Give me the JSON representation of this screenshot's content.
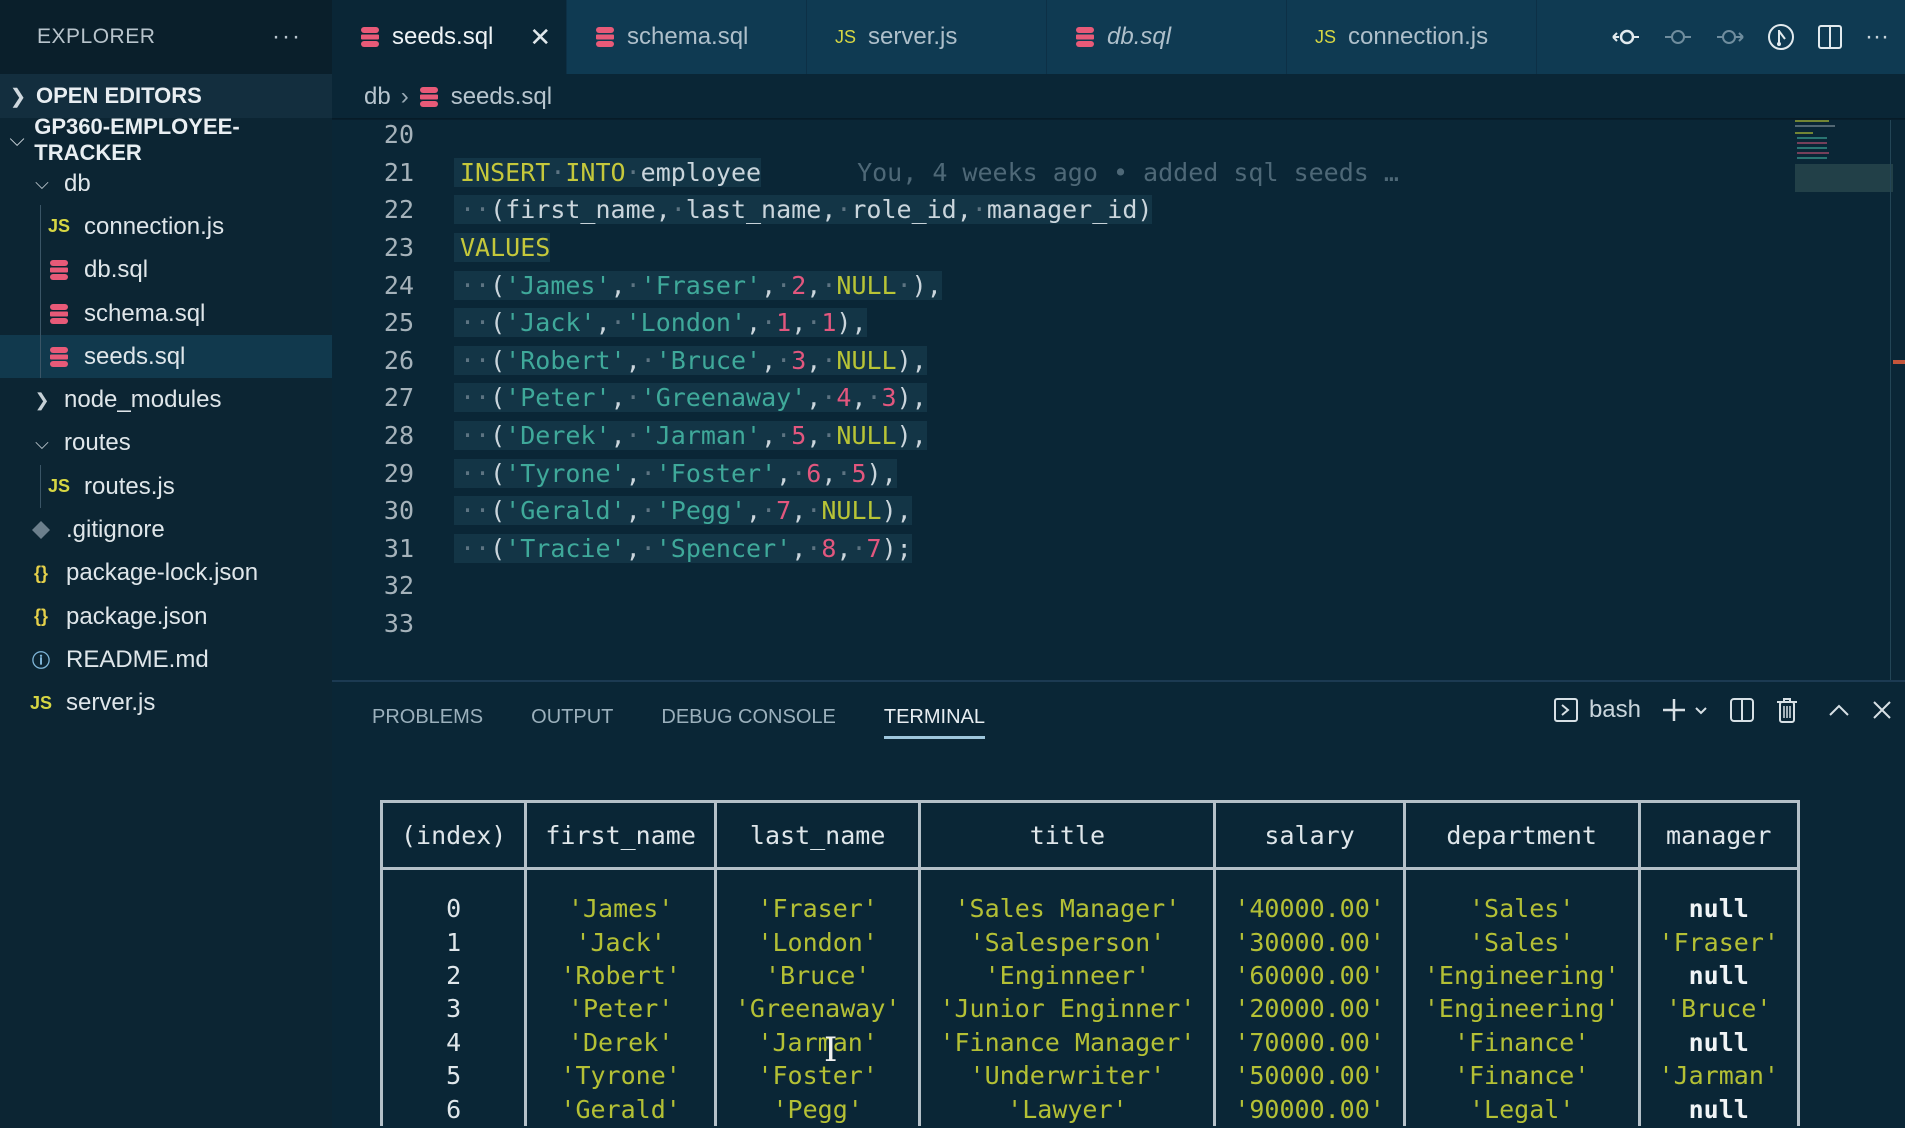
{
  "sidebar": {
    "title": "EXPLORER",
    "more": "···",
    "open_editors": "OPEN EDITORS",
    "project": "GP360-EMPLOYEE-TRACKER",
    "tree": [
      {
        "label": "db",
        "type": "folder",
        "expanded": true,
        "depth": 1
      },
      {
        "label": "connection.js",
        "type": "js",
        "depth": 2
      },
      {
        "label": "db.sql",
        "type": "sql",
        "depth": 2
      },
      {
        "label": "schema.sql",
        "type": "sql",
        "depth": 2
      },
      {
        "label": "seeds.sql",
        "type": "sql",
        "depth": 2,
        "selected": true
      },
      {
        "label": "node_modules",
        "type": "folder",
        "expanded": false,
        "depth": 1
      },
      {
        "label": "routes",
        "type": "folder",
        "expanded": true,
        "depth": 1
      },
      {
        "label": "routes.js",
        "type": "js",
        "depth": 2
      },
      {
        "label": ".gitignore",
        "type": "git",
        "depth": 1
      },
      {
        "label": "package-lock.json",
        "type": "json",
        "depth": 1
      },
      {
        "label": "package.json",
        "type": "json",
        "depth": 1
      },
      {
        "label": "README.md",
        "type": "info",
        "depth": 1
      },
      {
        "label": "server.js",
        "type": "js",
        "depth": 1
      }
    ]
  },
  "tabs": [
    {
      "label": "seeds.sql",
      "type": "sql",
      "active": true
    },
    {
      "label": "schema.sql",
      "type": "sql"
    },
    {
      "label": "server.js",
      "type": "js"
    },
    {
      "label": "db.sql",
      "type": "sql",
      "italic": true
    },
    {
      "label": "connection.js",
      "type": "js"
    }
  ],
  "icons": {
    "js": "JS",
    "json": "{}",
    "info": "ⓘ",
    "close": "✕",
    "chev_right": "›",
    "chev_down": "⌄",
    "more": "···"
  },
  "breadcrumb": {
    "folder": "db",
    "file": "seeds.sql"
  },
  "editor": {
    "blame": "You, 4 weeks ago • added sql seeds …",
    "lines": [
      {
        "n": "20",
        "tokens": []
      },
      {
        "n": "21",
        "tokens": [
          [
            "kw",
            "INSERT"
          ],
          [
            "ws",
            "·"
          ],
          [
            "kw",
            "INTO"
          ],
          [
            "ws",
            "·"
          ],
          [
            "plain",
            "employee"
          ]
        ],
        "blame": true
      },
      {
        "n": "22",
        "tokens": [
          [
            "ws",
            "··"
          ],
          [
            "plain",
            "(first_name,"
          ],
          [
            "ws",
            "·"
          ],
          [
            "plain",
            "last_name,"
          ],
          [
            "ws",
            "·"
          ],
          [
            "plain",
            "role_id,"
          ],
          [
            "ws",
            "·"
          ],
          [
            "plain",
            "manager_id)"
          ]
        ]
      },
      {
        "n": "23",
        "tokens": [
          [
            "kw",
            "VALUES"
          ]
        ]
      },
      {
        "n": "24",
        "tokens": [
          [
            "ws",
            "··"
          ],
          [
            "plain",
            "("
          ],
          [
            "str",
            "'James'"
          ],
          [
            "plain",
            ","
          ],
          [
            "ws",
            "·"
          ],
          [
            "str",
            "'Fraser'"
          ],
          [
            "plain",
            ","
          ],
          [
            "ws",
            "·"
          ],
          [
            "num",
            "2"
          ],
          [
            "plain",
            ","
          ],
          [
            "ws",
            "·"
          ],
          [
            "null",
            "NULL"
          ],
          [
            "ws",
            "·"
          ],
          [
            "plain",
            "),"
          ]
        ]
      },
      {
        "n": "25",
        "tokens": [
          [
            "ws",
            "··"
          ],
          [
            "plain",
            "("
          ],
          [
            "str",
            "'Jack'"
          ],
          [
            "plain",
            ","
          ],
          [
            "ws",
            "·"
          ],
          [
            "str",
            "'London'"
          ],
          [
            "plain",
            ","
          ],
          [
            "ws",
            "·"
          ],
          [
            "num",
            "1"
          ],
          [
            "plain",
            ","
          ],
          [
            "ws",
            "·"
          ],
          [
            "num",
            "1"
          ],
          [
            "plain",
            "),"
          ]
        ]
      },
      {
        "n": "26",
        "tokens": [
          [
            "ws",
            "··"
          ],
          [
            "plain",
            "("
          ],
          [
            "str",
            "'Robert'"
          ],
          [
            "plain",
            ","
          ],
          [
            "ws",
            "·"
          ],
          [
            "str",
            "'Bruce'"
          ],
          [
            "plain",
            ","
          ],
          [
            "ws",
            "·"
          ],
          [
            "num",
            "3"
          ],
          [
            "plain",
            ","
          ],
          [
            "ws",
            "·"
          ],
          [
            "null",
            "NULL"
          ],
          [
            "plain",
            "),"
          ]
        ]
      },
      {
        "n": "27",
        "tokens": [
          [
            "ws",
            "··"
          ],
          [
            "plain",
            "("
          ],
          [
            "str",
            "'Peter'"
          ],
          [
            "plain",
            ","
          ],
          [
            "ws",
            "·"
          ],
          [
            "str",
            "'Greenaway'"
          ],
          [
            "plain",
            ","
          ],
          [
            "ws",
            "·"
          ],
          [
            "num",
            "4"
          ],
          [
            "plain",
            ","
          ],
          [
            "ws",
            "·"
          ],
          [
            "num",
            "3"
          ],
          [
            "plain",
            "),"
          ]
        ]
      },
      {
        "n": "28",
        "tokens": [
          [
            "ws",
            "··"
          ],
          [
            "plain",
            "("
          ],
          [
            "str",
            "'Derek'"
          ],
          [
            "plain",
            ","
          ],
          [
            "ws",
            "·"
          ],
          [
            "str",
            "'Jarman'"
          ],
          [
            "plain",
            ","
          ],
          [
            "ws",
            "·"
          ],
          [
            "num",
            "5"
          ],
          [
            "plain",
            ","
          ],
          [
            "ws",
            "·"
          ],
          [
            "null",
            "NULL"
          ],
          [
            "plain",
            "),"
          ]
        ]
      },
      {
        "n": "29",
        "tokens": [
          [
            "ws",
            "··"
          ],
          [
            "plain",
            "("
          ],
          [
            "str",
            "'Tyrone'"
          ],
          [
            "plain",
            ","
          ],
          [
            "ws",
            "·"
          ],
          [
            "str",
            "'Foster'"
          ],
          [
            "plain",
            ","
          ],
          [
            "ws",
            "·"
          ],
          [
            "num",
            "6"
          ],
          [
            "plain",
            ","
          ],
          [
            "ws",
            "·"
          ],
          [
            "num",
            "5"
          ],
          [
            "plain",
            "),"
          ]
        ]
      },
      {
        "n": "30",
        "tokens": [
          [
            "ws",
            "··"
          ],
          [
            "plain",
            "("
          ],
          [
            "str",
            "'Gerald'"
          ],
          [
            "plain",
            ","
          ],
          [
            "ws",
            "·"
          ],
          [
            "str",
            "'Pegg'"
          ],
          [
            "plain",
            ","
          ],
          [
            "ws",
            "·"
          ],
          [
            "num",
            "7"
          ],
          [
            "plain",
            ","
          ],
          [
            "ws",
            "·"
          ],
          [
            "null",
            "NULL"
          ],
          [
            "plain",
            "),"
          ]
        ]
      },
      {
        "n": "31",
        "tokens": [
          [
            "ws",
            "··"
          ],
          [
            "plain",
            "("
          ],
          [
            "str",
            "'Tracie'"
          ],
          [
            "plain",
            ","
          ],
          [
            "ws",
            "·"
          ],
          [
            "str",
            "'Spencer'"
          ],
          [
            "plain",
            ","
          ],
          [
            "ws",
            "·"
          ],
          [
            "num",
            "8"
          ],
          [
            "plain",
            ","
          ],
          [
            "ws",
            "·"
          ],
          [
            "num",
            "7"
          ],
          [
            "plain",
            ");"
          ]
        ]
      },
      {
        "n": "32",
        "tokens": []
      },
      {
        "n": "33",
        "tokens": []
      }
    ]
  },
  "panel": {
    "tabs": [
      "PROBLEMS",
      "OUTPUT",
      "DEBUG CONSOLE",
      "TERMINAL"
    ],
    "active_tab": "TERMINAL",
    "shell": "bash",
    "table": {
      "columns": [
        "(index)",
        "first_name",
        "last_name",
        "title",
        "salary",
        "department",
        "manager"
      ],
      "rows": [
        [
          "0",
          "'James'",
          "'Fraser'",
          "'Sales Manager'",
          "'40000.00'",
          "'Sales'",
          "null"
        ],
        [
          "1",
          "'Jack'",
          "'London'",
          "'Salesperson'",
          "'30000.00'",
          "'Sales'",
          "'Fraser'"
        ],
        [
          "2",
          "'Robert'",
          "'Bruce'",
          "'Enginneer'",
          "'60000.00'",
          "'Engineering'",
          "null"
        ],
        [
          "3",
          "'Peter'",
          "'Greenaway'",
          "'Junior Enginner'",
          "'20000.00'",
          "'Engineering'",
          "'Bruce'"
        ],
        [
          "4",
          "'Derek'",
          "'Jarman'",
          "'Finance Manager'",
          "'70000.00'",
          "'Finance'",
          "null"
        ],
        [
          "5",
          "'Tyrone'",
          "'Foster'",
          "'Underwriter'",
          "'50000.00'",
          "'Finance'",
          "'Jarman'"
        ],
        [
          "6",
          "'Gerald'",
          "'Pegg'",
          "'Lawyer'",
          "'90000.00'",
          "'Legal'",
          "null"
        ]
      ]
    }
  },
  "colors": {
    "sql_icon": "#e85a78",
    "js_icon": "#d6d643",
    "keyword": "#c5c83b",
    "string": "#3fa99a",
    "number": "#e2577e",
    "terminal_string": "#b4c035"
  }
}
